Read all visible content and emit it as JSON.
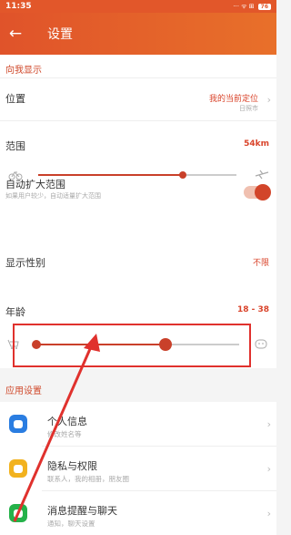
{
  "status": {
    "time": "11:35",
    "icons": "··· ᯤ ⊞",
    "battery": "76"
  },
  "header": {
    "title": "设置"
  },
  "show_me": {
    "section": "向我显示",
    "location": {
      "label": "位置",
      "value": "我的当前定位",
      "sub": "日照市"
    },
    "range": {
      "label": "范围",
      "value": "54km",
      "level": 0.73
    },
    "auto_expand": {
      "label": "自动扩大范围",
      "desc": "如果用户较少，自动适量扩大范围",
      "on": true
    },
    "gender": {
      "label": "显示性别",
      "value": "不限"
    },
    "age": {
      "label": "年龄",
      "value": "18 - 38",
      "low": 0.0,
      "high": 0.64
    }
  },
  "app_settings": {
    "section": "应用设置",
    "items": [
      {
        "title": "个人信息",
        "sub": "修改姓名等",
        "color": "#2a7de1"
      },
      {
        "title": "隐私与权限",
        "sub": "联系人，我的相册，朋友圈",
        "color": "#f2b21e"
      },
      {
        "title": "消息提醒与聊天",
        "sub": "通知，聊天设置",
        "color": "#25b24a"
      }
    ]
  },
  "colors": {
    "accent": "#d9432a",
    "highlight": "#e0312d"
  }
}
